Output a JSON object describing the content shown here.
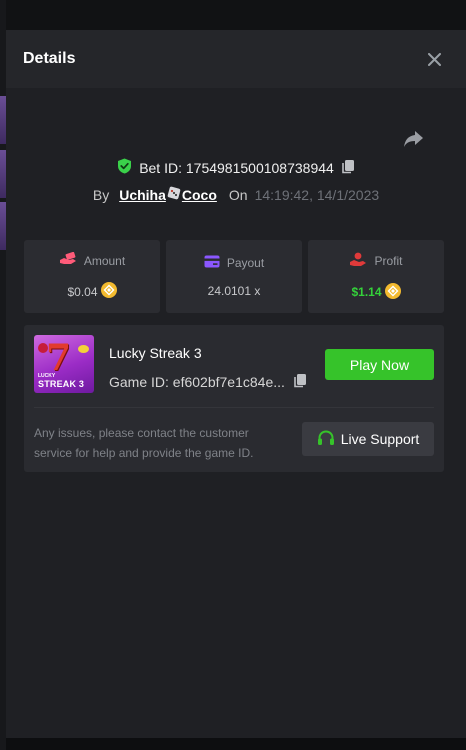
{
  "modal": {
    "title": "Details"
  },
  "bet": {
    "id_label": "Bet ID:",
    "id_value": "1754981500108738944",
    "by_label": "By",
    "user_first": "Uchiha",
    "user_second": "Coco",
    "on_label": "On",
    "time": "14:19:42, 14/1/2023"
  },
  "stats": [
    {
      "label": "Amount",
      "value": "$0.04",
      "icon": "money-hand-icon",
      "icon_color": "#ff5b79"
    },
    {
      "label": "Payout",
      "value": "24.0101 x",
      "icon": "card-icon",
      "icon_color": "#8b57ff"
    },
    {
      "label": "Profit",
      "value": "$1.14",
      "icon": "profit-hand-icon",
      "icon_color": "#e03a3a"
    }
  ],
  "game": {
    "name": "Lucky Streak 3",
    "id_label": "Game ID:",
    "id_value": "ef602bf7e1c84e...",
    "thumb_lucky": "LUCKY",
    "thumb_streak": "STREAK 3",
    "play_label": "Play Now",
    "help_text": "Any issues, please contact the customer service for help and provide the game ID.",
    "support_label": "Live Support"
  },
  "colors": {
    "accent_green": "#36c32a",
    "profit_green": "#34d23a",
    "shield_green": "#3ad14a",
    "coin_gold": "#f3ba2f"
  }
}
